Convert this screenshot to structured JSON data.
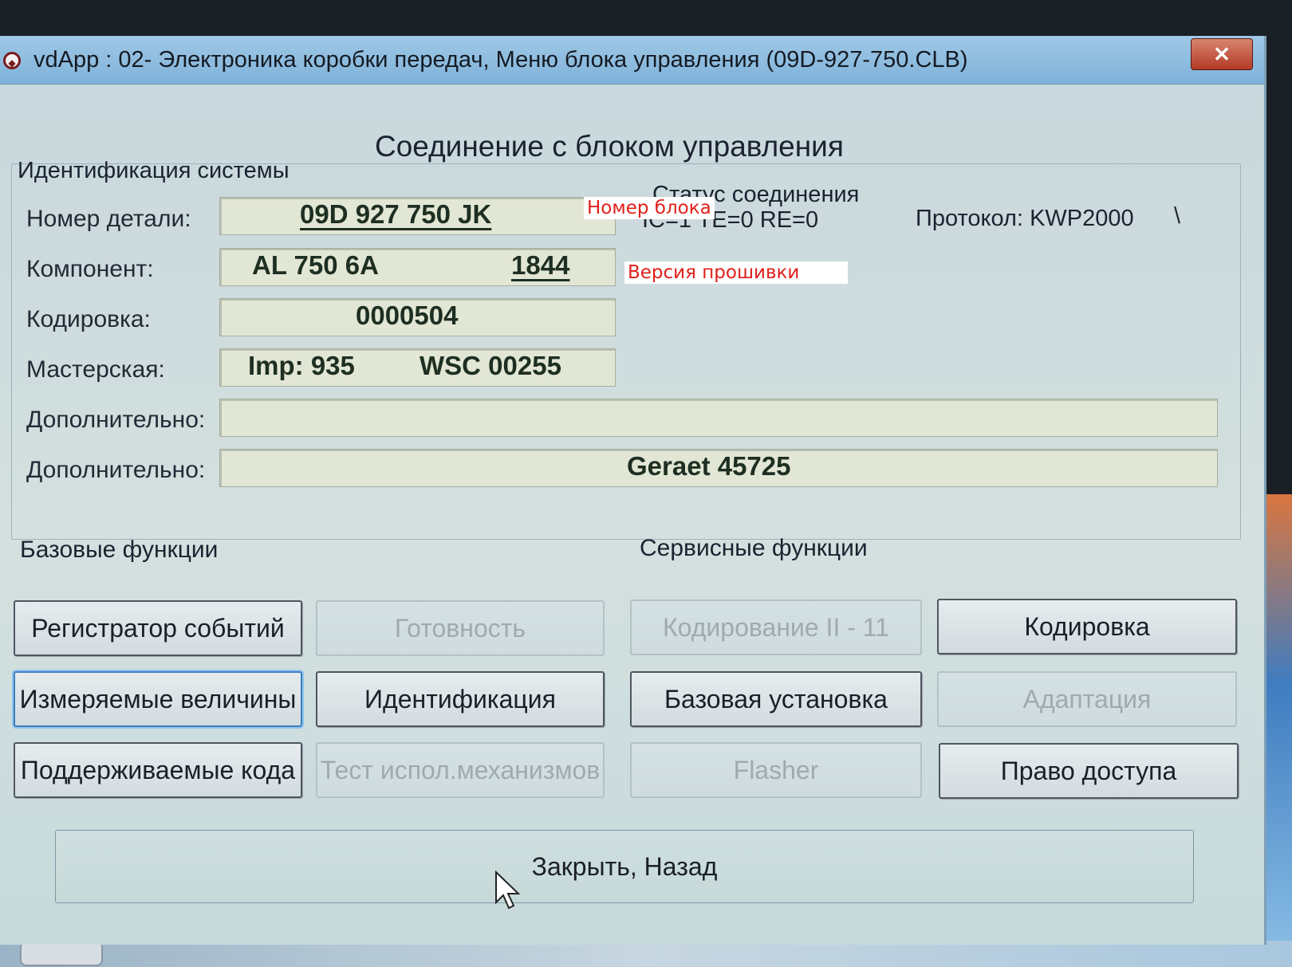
{
  "window": {
    "title": "vdApp : 02- Электроника коробки передач,  Меню блока управления (09D-927-750.CLB)",
    "close_label": "✕"
  },
  "heading": "Соединение с блоком управления",
  "identification": {
    "group_label": "Идентификация системы",
    "part_number_label": "Номер детали:",
    "part_number_value": "09D 927 750 JK",
    "component_label": "Компонент:",
    "component_value": "AL 750 6A",
    "component_version": "1844",
    "coding_label": "Кодировка:",
    "coding_value": "0000504",
    "workshop_label": "Мастерская:",
    "workshop_imp": "Imp: 935",
    "workshop_wsc": "WSC 00255",
    "additional1_label": "Дополнительно:",
    "additional1_value": "",
    "additional2_label": "Дополнительно:",
    "additional2_value": "Geraet 45725"
  },
  "connection_status": {
    "label": "Статус соединения",
    "status_text": "IC=1  TE=0   RE=0",
    "protocol_text": "Протокол: KWP2000",
    "indicator": "\\"
  },
  "annotations": {
    "block_number": "Номер блока",
    "firmware_version": "Версия прошивки"
  },
  "basic_functions": {
    "label": "Базовые функции",
    "event_recorder": "Регистратор событий",
    "readiness": "Готовность",
    "measured_values": "Измеряемые величины",
    "identification": "Идентификация",
    "supported_codes": "Поддерживаемые кода",
    "actuator_test": "Тест испол.механизмов"
  },
  "service_functions": {
    "label": "Сервисные функции",
    "coding_ii": "Кодирование II - 11",
    "coding": "Кодировка",
    "basic_settings": "Базовая установка",
    "adaptation": "Адаптация",
    "flasher": "Flasher",
    "access_right": "Право доступа"
  },
  "close_back_label": "Закрыть, Назад",
  "colors": {
    "titlebar": "#8fbde0",
    "window_bg": "#cfdcdc",
    "field_bg": "#e2e6d4",
    "value_text": "#1d2f22",
    "annotation_text": "#e0201a",
    "close_button": "#c04a33"
  }
}
